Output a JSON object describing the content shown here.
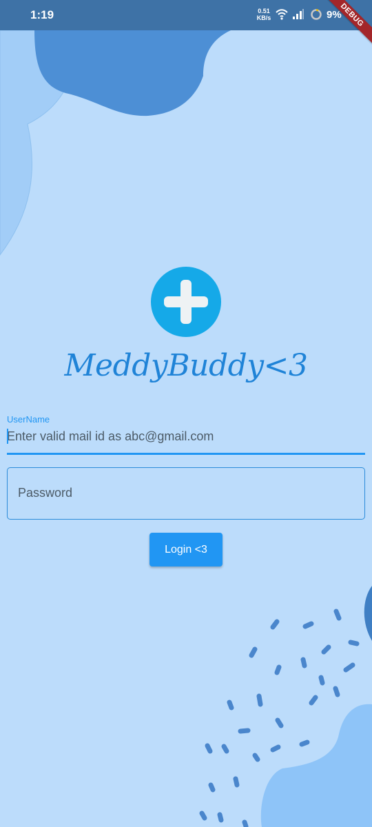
{
  "status_bar": {
    "time": "1:19",
    "speed_value": "0.51",
    "speed_unit": "KB/s",
    "battery": "9%"
  },
  "debug_banner": "DEBUG",
  "app": {
    "title": "MeddyBuddy<3"
  },
  "form": {
    "username_label": "UserName",
    "username_placeholder": "Enter valid mail id as abc@gmail.com",
    "password_placeholder": "Password",
    "login_label": "Login <3"
  },
  "colors": {
    "background": "#bcdcfb",
    "accent": "#2196f3",
    "logo_circle": "#15a9e8",
    "blob_dark": "#4d8fd5",
    "blob_light": "#8ec4f8"
  },
  "icons": [
    "wifi-icon",
    "signal-icon",
    "battery-icon",
    "plus-icon"
  ]
}
